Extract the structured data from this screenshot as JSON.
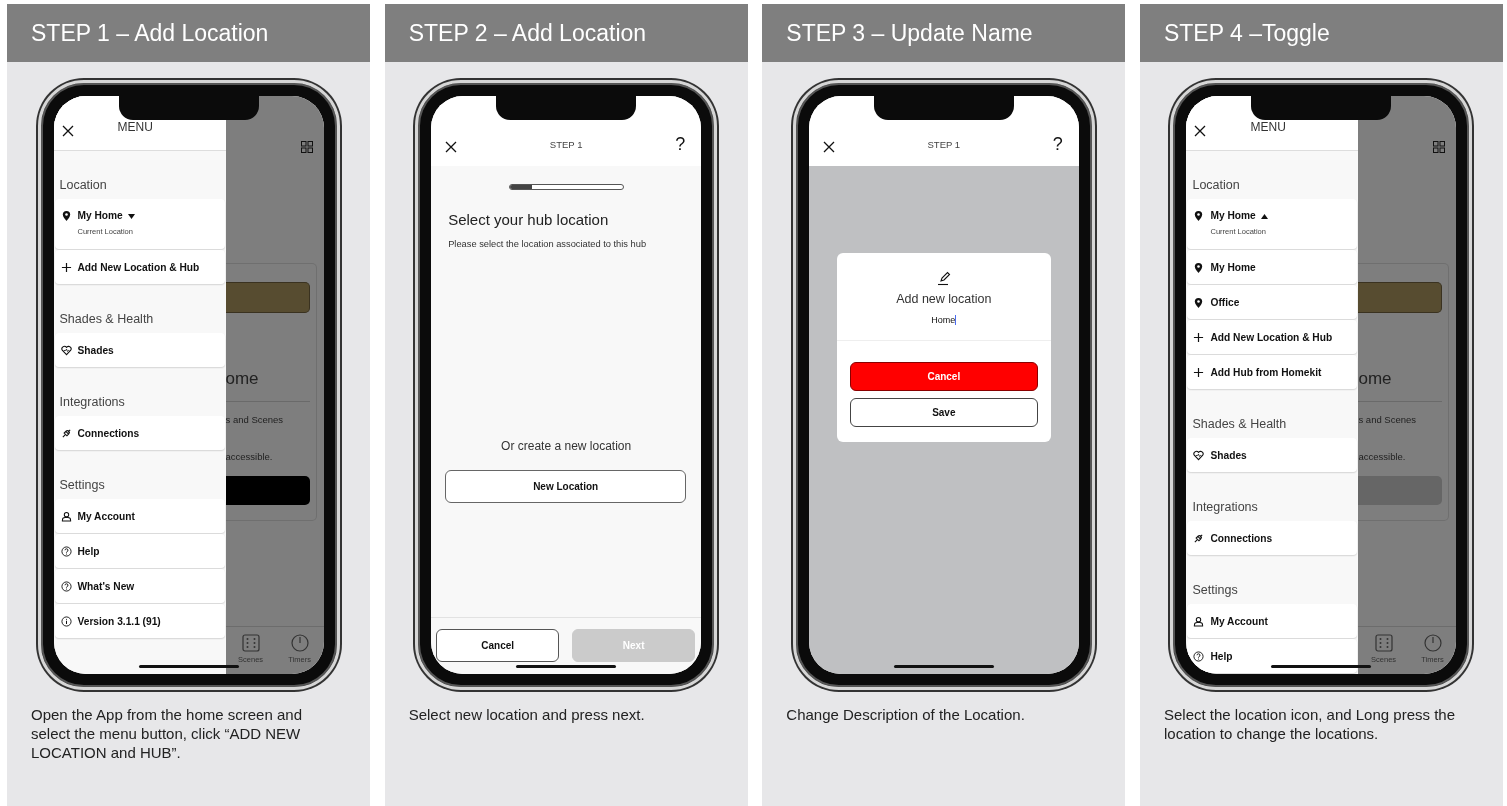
{
  "panels": [
    {
      "title": "STEP 1 – Add Location",
      "caption": "Open the App from the home screen and select the menu button, click “ADD NEW LOCATION and HUB”.",
      "screen": {
        "kind": "menu",
        "menu_title": "MENU",
        "sections": [
          {
            "heading": "Location",
            "items": [
              {
                "kind": "current",
                "label": "My Home",
                "sublabel": "Current Location",
                "expanded": false
              },
              {
                "kind": "add",
                "label": "Add New Location & Hub"
              }
            ]
          },
          {
            "heading": "Shades & Health",
            "items": [
              {
                "kind": "shades",
                "label": "Shades"
              }
            ]
          },
          {
            "heading": "Integrations",
            "items": [
              {
                "kind": "connection",
                "label": "Connections"
              }
            ]
          },
          {
            "heading": "Settings",
            "items": [
              {
                "kind": "account",
                "label": "My Account"
              },
              {
                "kind": "help",
                "label": "Help"
              },
              {
                "kind": "help",
                "label": "What's New"
              },
              {
                "kind": "info",
                "label": "Version 3.1.1 (91)"
              }
            ]
          }
        ],
        "behind": {
          "heading": "ome",
          "line_1": "s and Scenes",
          "line_2": "accessible.",
          "button_disabled": false,
          "nav": [
            {
              "kind": "scenes",
              "label": "Scenes"
            },
            {
              "kind": "timers",
              "label": "Timers"
            }
          ]
        }
      }
    },
    {
      "title": "STEP 2 – Add Location",
      "caption": "Select new location and press next.",
      "screen": {
        "kind": "wizard",
        "step": "STEP 1",
        "help": "?",
        "progress": {
          "level": 0.2
        },
        "title": "Select your hub location",
        "description": "Please select the location associated to this hub",
        "alt_prompt": "Or create a new location",
        "new_button": "New Location",
        "buttons": [
          {
            "label": "Cancel",
            "disabled": false
          },
          {
            "label": "Next",
            "disabled": true
          }
        ]
      }
    },
    {
      "title": "STEP 3 – Update Name",
      "caption": "Change Description of the Location.",
      "screen": {
        "kind": "dialog",
        "step": "STEP 1",
        "help": "?",
        "dialog": {
          "title": "Add new location",
          "value": "Home",
          "buttons": [
            {
              "label": "Cancel",
              "primary": true
            },
            {
              "label": "Save",
              "primary": false
            }
          ]
        }
      }
    },
    {
      "title": "STEP 4 –Toggle",
      "caption": "Select the location icon, and Long press the location to change the locations.",
      "screen": {
        "kind": "menu",
        "menu_title": "MENU",
        "sections": [
          {
            "heading": "Location",
            "items": [
              {
                "kind": "current",
                "label": "My Home",
                "sublabel": "Current Location",
                "expanded": true
              },
              {
                "kind": "location",
                "label": "My Home"
              },
              {
                "kind": "location",
                "label": "Office"
              },
              {
                "kind": "add",
                "label": "Add New Location & Hub"
              },
              {
                "kind": "add",
                "label": "Add Hub from Homekit"
              }
            ]
          },
          {
            "heading": "Shades & Health",
            "items": [
              {
                "kind": "shades",
                "label": "Shades"
              }
            ]
          },
          {
            "heading": "Integrations",
            "items": [
              {
                "kind": "connection",
                "label": "Connections"
              }
            ]
          },
          {
            "heading": "Settings",
            "items": [
              {
                "kind": "account",
                "label": "My Account"
              },
              {
                "kind": "help",
                "label": "Help"
              }
            ]
          }
        ],
        "behind": {
          "heading": "ome",
          "line_1": "s and Scenes",
          "line_2": "accessible.",
          "button_disabled": true,
          "nav": [
            {
              "kind": "scenes",
              "label": "Scenes"
            },
            {
              "kind": "timers",
              "label": "Timers"
            }
          ]
        }
      }
    }
  ]
}
